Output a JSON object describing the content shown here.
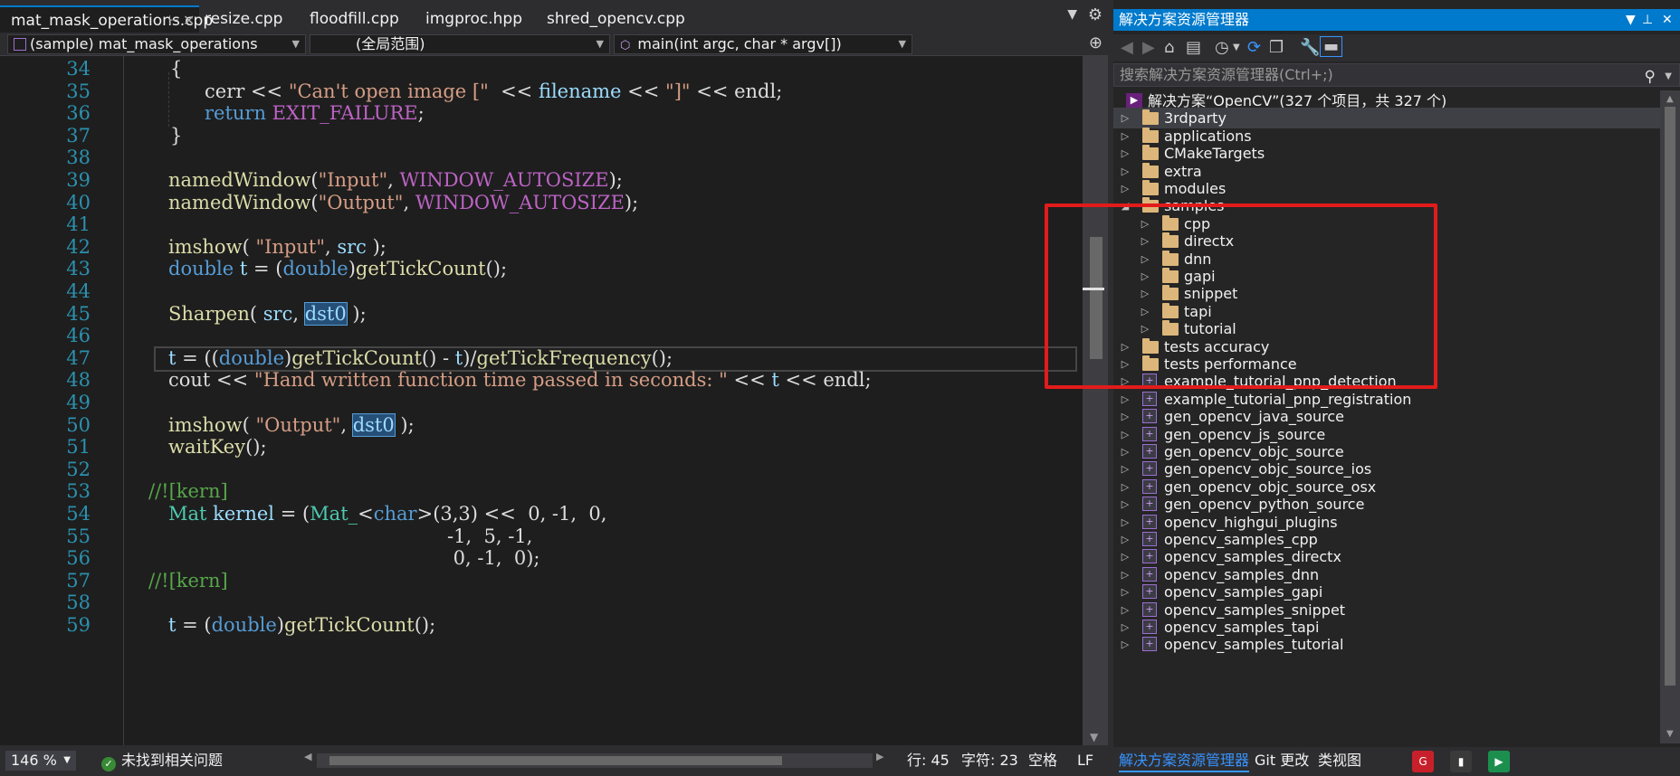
{
  "editor": {
    "tabs": [
      {
        "label": "mat_mask_operations.cpp",
        "active": true
      },
      {
        "label": "resize.cpp"
      },
      {
        "label": "floodfill.cpp"
      },
      {
        "label": "imgproc.hpp"
      },
      {
        "label": "shred_opencv.cpp"
      }
    ],
    "navbar": {
      "project": "(sample) mat_mask_operations",
      "scope": "(全局范围)",
      "function": "main(int argc, char * argv[])"
    },
    "line_numbers": [
      "34",
      "35",
      "36",
      "37",
      "38",
      "39",
      "40",
      "41",
      "42",
      "43",
      "44",
      "45",
      "46",
      "47",
      "48",
      "49",
      "50",
      "51",
      "52",
      "53",
      "54",
      "55",
      "56",
      "57",
      "58",
      "59"
    ],
    "code": {
      "l34": "{",
      "l35_a": "cerr << ",
      "l35_b": "\"Can't open image [\"",
      "l35_c": "  << ",
      "l35_d": "filename",
      "l35_e": " << ",
      "l35_f": "\"]\"",
      "l35_g": " << endl;",
      "l36_a": "return ",
      "l36_b": "EXIT_FAILURE",
      "l36_c": ";",
      "l37": "}",
      "l39_a": "namedWindow",
      "l39_b": "(",
      "l39_c": "\"Input\"",
      "l39_d": ", ",
      "l39_e": "WINDOW_AUTOSIZE",
      "l39_f": ");",
      "l40_a": "namedWindow",
      "l40_b": "(",
      "l40_c": "\"Output\"",
      "l40_d": ", ",
      "l40_e": "WINDOW_AUTOSIZE",
      "l40_f": ");",
      "l42_a": "imshow",
      "l42_b": "( ",
      "l42_c": "\"Input\"",
      "l42_d": ", ",
      "l42_e": "src",
      "l42_f": " );",
      "l43_a": "double",
      "l43_b": " ",
      "l43_c": "t",
      "l43_d": " = (",
      "l43_e": "double",
      "l43_f": ")",
      "l43_g": "getTickCount",
      "l43_h": "();",
      "l45_a": "Sharpen",
      "l45_b": "( ",
      "l45_c": "src",
      "l45_d": ", ",
      "l45_e": "dst0",
      "l45_f": " );",
      "l47_a": "t",
      "l47_b": " = ((",
      "l47_c": "double",
      "l47_d": ")",
      "l47_e": "getTickCount",
      "l47_f": "() - ",
      "l47_g": "t",
      "l47_h": ")/",
      "l47_i": "getTickFrequency",
      "l47_j": "();",
      "l48_a": "cout << ",
      "l48_b": "\"Hand written function time passed in seconds: \"",
      "l48_c": " << ",
      "l48_d": "t",
      "l48_e": " << endl;",
      "l50_a": "imshow",
      "l50_b": "( ",
      "l50_c": "\"Output\"",
      "l50_d": ", ",
      "l50_e": "dst0",
      "l50_f": " );",
      "l51_a": "waitKey",
      "l51_b": "();",
      "l53": "//![kern]",
      "l54_a": "Mat",
      "l54_b": " ",
      "l54_c": "kernel",
      "l54_d": " = (",
      "l54_e": "Mat_",
      "l54_f": "<",
      "l54_g": "char",
      "l54_h": ">(3,3) <<  0, -1,  0,",
      "l55": "-1,  5, -1,",
      "l56": " 0, -1,  0);",
      "l57": "//![kern]",
      "l59_a": "t",
      "l59_b": " = (",
      "l59_c": "double",
      "l59_d": ")",
      "l59_e": "getTickCount",
      "l59_f": "();"
    },
    "status": {
      "zoom": "146 %",
      "issues": "未找到相关问题",
      "line": "行: 45",
      "char": "字符: 23",
      "whitespace": "空格",
      "eol": "LF"
    }
  },
  "solution_explorer": {
    "title": "解决方案资源管理器",
    "search_placeholder": "搜索解决方案资源管理器(Ctrl+;)",
    "solution_label": "解决方案“OpenCV”(327 个项目，共 327 个)",
    "items": [
      {
        "label": "3rdparty",
        "type": "folder",
        "level": 1,
        "expanded": false
      },
      {
        "label": "applications",
        "type": "folder",
        "level": 1,
        "expanded": false
      },
      {
        "label": "CMakeTargets",
        "type": "folder",
        "level": 1,
        "expanded": false
      },
      {
        "label": "extra",
        "type": "folder",
        "level": 1,
        "expanded": false
      },
      {
        "label": "modules",
        "type": "folder",
        "level": 1,
        "expanded": false
      },
      {
        "label": "samples",
        "type": "folder",
        "level": 1,
        "expanded": true
      },
      {
        "label": "cpp",
        "type": "folder",
        "level": 2,
        "expanded": false
      },
      {
        "label": "directx",
        "type": "folder",
        "level": 2,
        "expanded": false
      },
      {
        "label": "dnn",
        "type": "folder",
        "level": 2,
        "expanded": false
      },
      {
        "label": "gapi",
        "type": "folder",
        "level": 2,
        "expanded": false
      },
      {
        "label": "snippet",
        "type": "folder",
        "level": 2,
        "expanded": false
      },
      {
        "label": "tapi",
        "type": "folder",
        "level": 2,
        "expanded": false
      },
      {
        "label": "tutorial",
        "type": "folder",
        "level": 2,
        "expanded": false
      },
      {
        "label": "tests accuracy",
        "type": "folder",
        "level": 1,
        "expanded": false
      },
      {
        "label": "tests performance",
        "type": "folder",
        "level": 1,
        "expanded": false
      },
      {
        "label": "example_tutorial_pnp_detection",
        "type": "project",
        "level": 1,
        "expanded": false
      },
      {
        "label": "example_tutorial_pnp_registration",
        "type": "project",
        "level": 1,
        "expanded": false
      },
      {
        "label": "gen_opencv_java_source",
        "type": "project",
        "level": 1,
        "expanded": false
      },
      {
        "label": "gen_opencv_js_source",
        "type": "project",
        "level": 1,
        "expanded": false
      },
      {
        "label": "gen_opencv_objc_source",
        "type": "project",
        "level": 1,
        "expanded": false
      },
      {
        "label": "gen_opencv_objc_source_ios",
        "type": "project",
        "level": 1,
        "expanded": false
      },
      {
        "label": "gen_opencv_objc_source_osx",
        "type": "project",
        "level": 1,
        "expanded": false
      },
      {
        "label": "gen_opencv_python_source",
        "type": "project",
        "level": 1,
        "expanded": false
      },
      {
        "label": "opencv_highgui_plugins",
        "type": "project",
        "level": 1,
        "expanded": false
      },
      {
        "label": "opencv_samples_cpp",
        "type": "project",
        "level": 1,
        "expanded": false
      },
      {
        "label": "opencv_samples_directx",
        "type": "project",
        "level": 1,
        "expanded": false
      },
      {
        "label": "opencv_samples_dnn",
        "type": "project",
        "level": 1,
        "expanded": false
      },
      {
        "label": "opencv_samples_gapi",
        "type": "project",
        "level": 1,
        "expanded": false
      },
      {
        "label": "opencv_samples_snippet",
        "type": "project",
        "level": 1,
        "expanded": false
      },
      {
        "label": "opencv_samples_tapi",
        "type": "project",
        "level": 1,
        "expanded": false
      },
      {
        "label": "opencv_samples_tutorial",
        "type": "project",
        "level": 1,
        "expanded": false
      }
    ],
    "bottom_tabs": [
      "解决方案资源管理器",
      "Git 更改",
      "类视图"
    ]
  },
  "colors": {
    "accent": "#007acc",
    "highlight_box": "#e21b1b",
    "folder": "#dcb67a"
  },
  "icons": {
    "tab_close": "close-icon",
    "tab_pin": "pin-icon",
    "settings": "gear-icon",
    "search": "search-icon"
  }
}
